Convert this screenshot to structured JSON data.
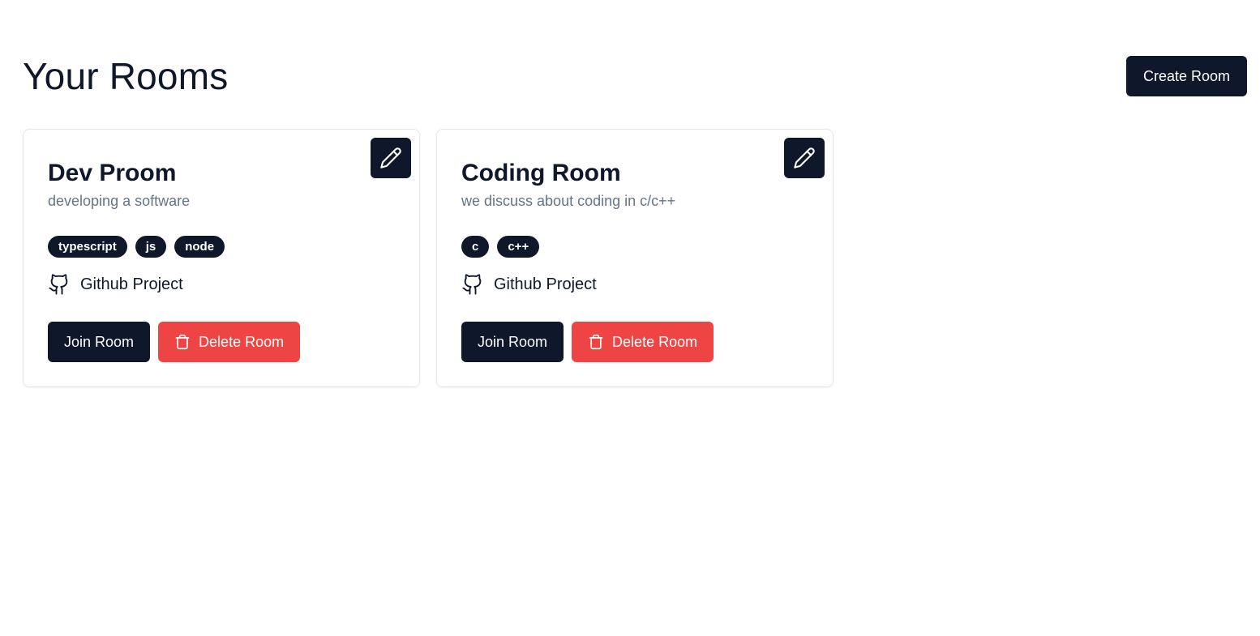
{
  "header": {
    "title": "Your Rooms",
    "create_label": "Create Room"
  },
  "rooms": [
    {
      "name": "Dev Proom",
      "description": "developing a software",
      "tags": [
        "typescript",
        "js",
        "node"
      ],
      "github_label": "Github Project",
      "join_label": "Join Room",
      "delete_label": "Delete Room"
    },
    {
      "name": "Coding Room",
      "description": "we discuss about coding in c/c++",
      "tags": [
        "c",
        "c++"
      ],
      "github_label": "Github Project",
      "join_label": "Join Room",
      "delete_label": "Delete Room"
    }
  ],
  "icons": {
    "edit": "pencil-icon",
    "github": "github-icon",
    "delete": "trash-icon"
  },
  "colors": {
    "primary": "#0f172a",
    "danger": "#ef4444",
    "muted_text": "#64748b",
    "card_border": "#e2e8f0"
  }
}
